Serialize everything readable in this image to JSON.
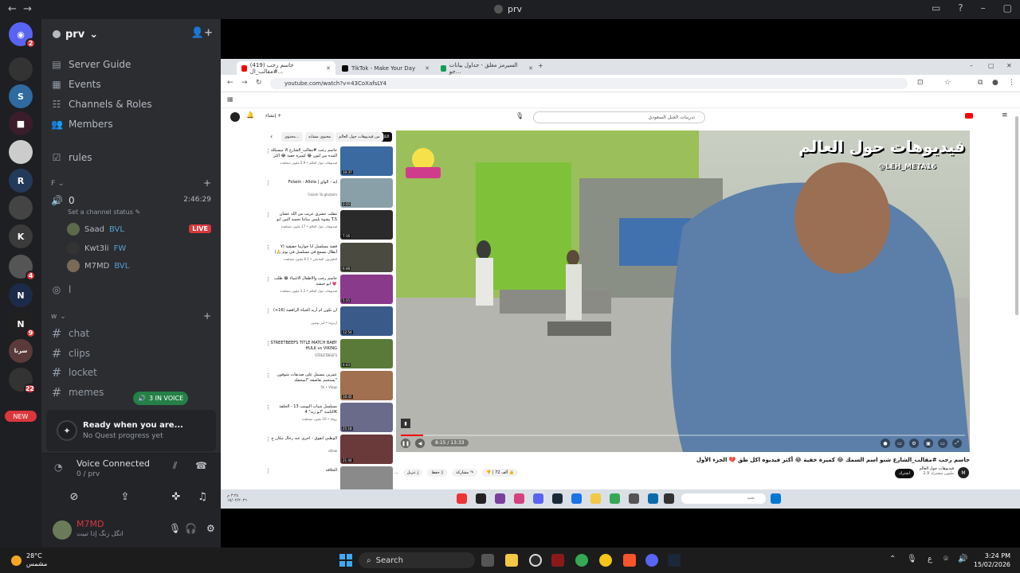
{
  "window": {
    "title": "prv",
    "nav_back": "←",
    "nav_fwd": "→",
    "help_icon": "?",
    "minimize": "–"
  },
  "rail": {
    "new_label": "NEW",
    "badges": [
      "2",
      "4",
      "9",
      "22"
    ]
  },
  "server": {
    "name": "prv",
    "chevron": "⌄",
    "invite_icon": "👤+"
  },
  "nav": [
    {
      "label": "Server Guide",
      "icon": "▤"
    },
    {
      "label": "Events",
      "icon": "▦"
    },
    {
      "label": "Channels & Roles",
      "icon": "☷"
    },
    {
      "label": "Members",
      "icon": "👥"
    }
  ],
  "rules_channel": "rules",
  "category_f": "F",
  "voice_channel": {
    "name": "0",
    "timer": "2:46:29",
    "status": "Set a channel status"
  },
  "voice_users": [
    {
      "name": "Saad",
      "tag": "BVL",
      "live": "LIVE"
    },
    {
      "name": "Kwt3li",
      "tag": "FW"
    },
    {
      "name": "M7MD",
      "tag": "BVL"
    }
  ],
  "stage_channel": "l",
  "category_w": "w",
  "channels": [
    "chat",
    "clips",
    "locket",
    "memes"
  ],
  "in_voice": "3 IN VOICE",
  "quest": {
    "title": "Ready when you are...",
    "subtitle": "No Quest progress yet"
  },
  "voice_status": {
    "title": "Voice Connected",
    "subtitle": "0 / prv"
  },
  "user": {
    "name": "M7MD",
    "status": "انگل زنگ إذا تبيت"
  },
  "browser": {
    "tabs": [
      "(419) جاسم رجب #مقالب_ال...",
      "TikTok - Make Your Day",
      "السيرمز مغلق - جداول بيانات جو..."
    ],
    "new_tab": "+",
    "url": "youtube.com/watch?v=43CoXafsLY4",
    "win_controls": [
      "–",
      "▢",
      "✕"
    ]
  },
  "youtube": {
    "search": "تدريبات الجبل السعودي",
    "create_label": "إنشاء",
    "chips": [
      "الكل",
      "من فيديوهات حول العالم",
      "محتوى مشابه",
      "محتوى..."
    ],
    "related": [
      {
        "title": "جاسم رجب #مقالب_الشارع الا ميسكلة المدة بين لتون 😂 كميرة خفية 😂 اكثر",
        "meta": "فيديوهات حول العالم • 2.9 مليون مشاهدة",
        "dur": "10:37"
      },
      {
        "title": "Folaim - Allola | ايه - الواي",
        "meta": "Folaim Ya ghotaim",
        "dur": "2:35"
      },
      {
        "title": "مقلب عشري عريب من الله عشان يشوه يلبس سانتا تحميه التين ابو T.S",
        "meta": "فيديوهات حول العالم • 17 مليون مشاهدة",
        "dur": "7:16"
      },
      {
        "title": "قصة مسلسل ابا جوارما حقيقية (٧ أبطال بسمع في مسلسل في يوم 🙏)",
        "meta": "التلفزيون التفاعلي • 8.1 مليون مشاهدة",
        "dur": "6:48"
      },
      {
        "title": "جاسم رجب والاطفال الاغبياء 😂 طلب ابو حبشة 💗",
        "meta": "فيديوهات حول العالم • 1.2 مليون مشاهدة",
        "dur": "5:35"
      },
      {
        "title": "ان تكون ام أريد الحياة الرافضة (16+)",
        "meta": "أريزونا • أمر يوميين",
        "dur": "12:54"
      },
      {
        "title": "STREETBEEFS TITLE MATCH BABY HULK vs VIKING",
        "meta": "STREETBEEFS",
        "dur": "4:43"
      },
      {
        "title": "عمرين يتسمل على صديقات شوفون يستحيم بعاصفة \"اسحقله\"",
        "meta": "5k • Vlogs",
        "dur": "10:45"
      },
      {
        "title": "مسلسل شباب البومب 13 - الحلقة الثامنة \"ابو زيد\" 4K",
        "meta": "روتانا • 10 مليون مشاهدة",
        "dur": "25:18"
      },
      {
        "title": "الوطني اتفوق - احرى عند رحال مكان ج",
        "meta": "sillow",
        "dur": "21:44"
      },
      {
        "title": "الحلاقة",
        "meta": "",
        "dur": ""
      }
    ],
    "video": {
      "overlay_title": "فيديوهات حول العالم",
      "overlay_handle": "@LEH_META16",
      "time": "8:15 / 13:33",
      "progress": 0.04,
      "title": "جاسم رجب #مقالب_الشارع شنو اسم السمك 😂 كميرة خفية 😂 أكثر فيديوه اكل طق 💔 الجزء الأول",
      "channel": "فيديوهات حول العالم",
      "subs": "2.9 مليون مشترك",
      "subscribe": "اشترك",
      "likes": "72 ألف",
      "share": "مشاركة",
      "save": "حفظ",
      "download": "تنزيل",
      "more": "..."
    },
    "inner_taskbar": {
      "search": "بحث",
      "clock": "٣:٢٤ م\n١٥/٠٢/٢٠٢٦"
    }
  },
  "taskbar": {
    "weather_temp": "28°C",
    "weather_desc": "مشمس",
    "search": "Search",
    "lang": "ع",
    "time": "3:24 PM",
    "date": "15/02/2026"
  },
  "colors": {
    "discord_bg": "#2b2d31",
    "rail_bg": "#1e1f22",
    "accent_red": "#da373c",
    "live_red": "#da373c",
    "green": "#248046"
  }
}
